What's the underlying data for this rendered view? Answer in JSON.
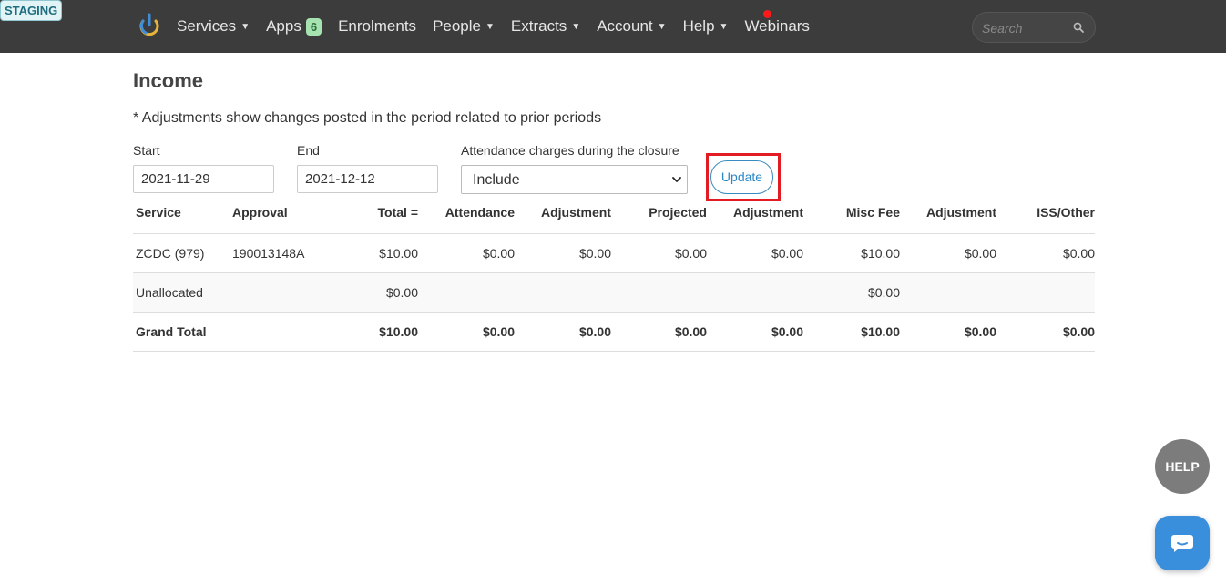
{
  "env_badge": "STAGING",
  "nav": {
    "items": [
      {
        "label": "Services",
        "has_dropdown": true
      },
      {
        "label": "Apps",
        "badge": "6",
        "has_dropdown": false
      },
      {
        "label": "Enrolments",
        "has_dropdown": false
      },
      {
        "label": "People",
        "has_dropdown": true
      },
      {
        "label": "Extracts",
        "has_dropdown": true
      },
      {
        "label": "Account",
        "has_dropdown": true
      },
      {
        "label": "Help",
        "has_dropdown": true
      },
      {
        "label": "Webinars",
        "has_dropdown": false
      }
    ],
    "caret": "▼",
    "search_placeholder": "Search"
  },
  "page": {
    "title": "Income",
    "note": "* Adjustments show changes posted in the period related to prior periods"
  },
  "filters": {
    "start_label": "Start",
    "start_value": "2021-11-29",
    "end_label": "End",
    "end_value": "2021-12-12",
    "closure_label": "Attendance charges during the closure",
    "closure_value": "Include",
    "update_label": "Update"
  },
  "table": {
    "headers": [
      "Service",
      "Approval",
      "Total =",
      "Attendance",
      "Adjustment",
      "Projected",
      "Adjustment",
      "Misc Fee",
      "Adjustment",
      "ISS/Other"
    ],
    "rows": [
      [
        "ZCDC (979)",
        "190013148A",
        "$10.00",
        "$0.00",
        "$0.00",
        "$0.00",
        "$0.00",
        "$10.00",
        "$0.00",
        "$0.00"
      ],
      [
        "Unallocated",
        "",
        "$0.00",
        "",
        "",
        "",
        "",
        "$0.00",
        "",
        ""
      ]
    ],
    "total_row": [
      "Grand Total",
      "",
      "$10.00",
      "$0.00",
      "$0.00",
      "$0.00",
      "$0.00",
      "$10.00",
      "$0.00",
      "$0.00"
    ]
  },
  "floating": {
    "help_label": "HELP"
  },
  "colors": {
    "topbar": "#3c3c3c",
    "accent": "#2a86c5",
    "highlight": "#e31b23",
    "notify": "#ff1a1a"
  }
}
